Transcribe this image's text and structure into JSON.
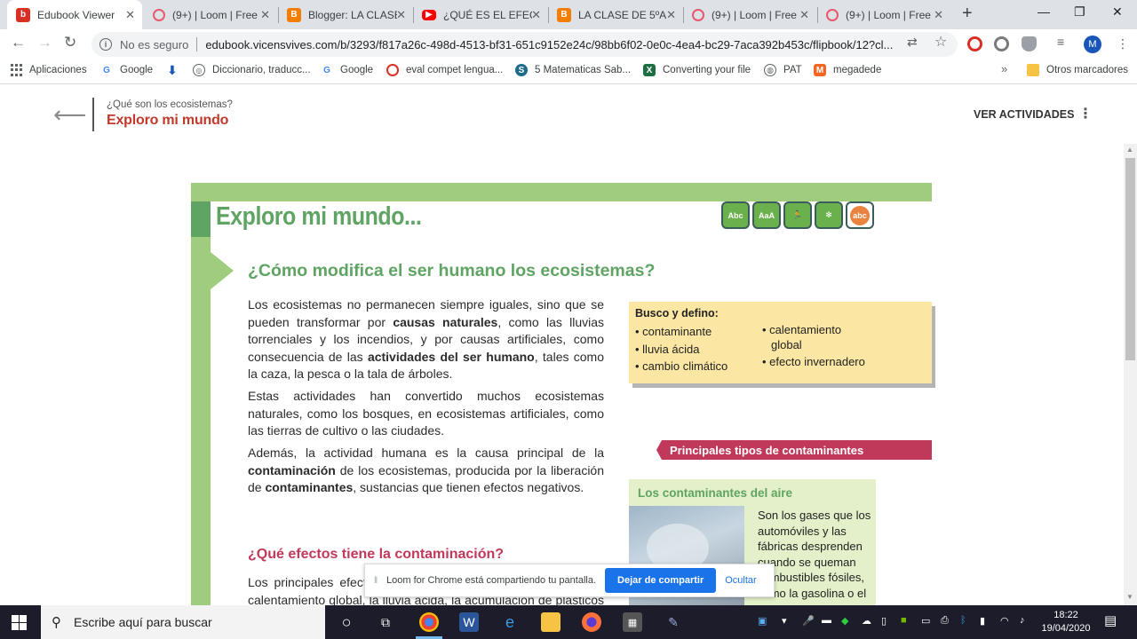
{
  "browser": {
    "tabs": [
      {
        "title": "Edubook Viewer",
        "active": true,
        "favicon": "b",
        "favicon_color": "#d93025"
      },
      {
        "title": "(9+) | Loom | Free",
        "active": false,
        "favicon": "loom",
        "favicon_color": "#e8596f"
      },
      {
        "title": "Blogger: LA CLASE",
        "active": false,
        "favicon": "B",
        "favicon_color": "#f57d00"
      },
      {
        "title": "¿QUÉ ES EL EFECTO",
        "active": false,
        "favicon": "yt",
        "favicon_color": "#ff0000"
      },
      {
        "title": "LA CLASE DE 5ºA",
        "active": false,
        "favicon": "B",
        "favicon_color": "#f57d00"
      },
      {
        "title": "(9+) | Loom | Free",
        "active": false,
        "favicon": "loom",
        "favicon_color": "#e8596f"
      },
      {
        "title": "(9+) | Loom | Free",
        "active": false,
        "favicon": "loom",
        "favicon_color": "#e8596f"
      }
    ],
    "new_tab": "+",
    "window_controls": {
      "minimize": "—",
      "maximize": "❐",
      "close": "✕"
    },
    "address": {
      "security_label": "No es seguro",
      "url": "edubook.vicensvives.com/b/3293/f817a26c-498d-4513-bf31-651c9152e24c/98bb6f02-0e0c-4ea4-bc29-7aca392b453c/flipbook/12?cl..."
    },
    "avatar_letter": "M",
    "bookmarks": [
      {
        "label": "Aplicaciones",
        "icon": "apps-icon"
      },
      {
        "label": "Google",
        "icon": "google-icon"
      },
      {
        "label": "",
        "icon": "download-icon"
      },
      {
        "label": "Diccionario, traducc...",
        "icon": "dictionary-icon"
      },
      {
        "label": "Google",
        "icon": "google-icon"
      },
      {
        "label": "eval compet lengua...",
        "icon": "target-icon"
      },
      {
        "label": "5 Matematicas Sab...",
        "icon": "math-icon"
      },
      {
        "label": "Converting your file",
        "icon": "excel-icon"
      },
      {
        "label": "PAT",
        "icon": "globe-icon"
      },
      {
        "label": "megadede",
        "icon": "megadede-icon"
      }
    ],
    "bookmarks_more": "»",
    "other_bookmarks": "Otros marcadores"
  },
  "app_header": {
    "subtitle": "¿Qué son los ecosistemas?",
    "title": "Exploro mi mundo",
    "activities_label": "VER ACTIVIDADES"
  },
  "page": {
    "title": "Exploro mi mundo...",
    "badges": [
      "Abc",
      "AaA",
      "run",
      "fig",
      "abc"
    ],
    "heading": "¿Cómo modifica el ser humano los ecosistemas?",
    "paragraph1": {
      "t1": "Los ecosistemas no permanecen siempre iguales, sino que se pueden transformar por ",
      "b1": "causas naturales",
      "t2": ", como las lluvias torrenciales y los incendios, y por causas artificiales, como consecuencia de las ",
      "b2": "actividades del ser humano",
      "t3": ", tales como la caza, la pesca o la tala de árboles."
    },
    "paragraph2": "Estas actividades han convertido muchos ecosistemas naturales, como los bosques, en ecosistemas artificiales, como las tierras de cultivo o las ciudades.",
    "paragraph3": {
      "t1": "Además, la actividad humana es la causa principal de la ",
      "b1": "contaminación",
      "t2": " de los ecosistemas, producida por la liberación de ",
      "b2": "contaminantes",
      "t3": ", sustancias que tienen efectos negativos."
    },
    "subheading": "¿Qué efectos tiene la contaminación?",
    "paragraph4": "Los principales efectos de la contaminación ambiental son el calentamiento global, la lluvia ácida, la acumulación de plásticos en los océanos y la contaminación del agua y del suelo.",
    "busco": {
      "title": "Busco y defino:",
      "col1": [
        "contaminante",
        "lluvia ácida",
        "cambio climático"
      ],
      "col2_first": "calentamiento",
      "col2_first_cont": "global",
      "col2_second": "efecto invernadero"
    },
    "tipos_label": "Principales tipos de contaminantes",
    "aire": {
      "title": "Los contaminantes del aire",
      "text": "Son los gases que los automóviles y las fábricas desprenden cuando se queman combustibles fósiles, como la gasolina o el"
    }
  },
  "loom_bar": {
    "message": "Loom for Chrome está compartiendo tu pantalla.",
    "stop_label": "Dejar de compartir",
    "hide_label": "Ocultar"
  },
  "taskbar": {
    "search_placeholder": "Escribe aquí para buscar",
    "time": "18:22",
    "date": "19/04/2020"
  }
}
